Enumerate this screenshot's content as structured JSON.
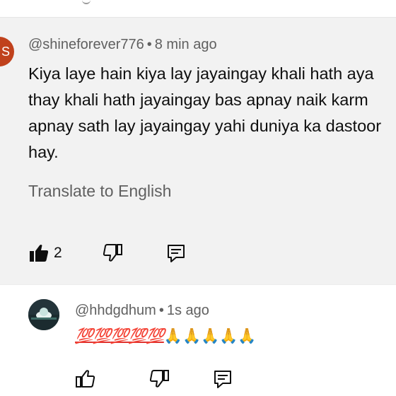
{
  "main_comment": {
    "avatar_letter": "S",
    "avatar_color": "#c0411c",
    "handle": "@shineforever776",
    "separator": "•",
    "time": "8 min ago",
    "body": "Kiya laye hain kiya lay jayaingay khali hath aya thay khali hath jayaingay bas apnay naik karm apnay sath lay jayaingay yahi duniya ka dastoor hay.",
    "translate_label": "Translate to English",
    "like_count": "2",
    "icons": {
      "like": "thumbs-up-filled-icon",
      "dislike": "thumbs-down-icon",
      "reply": "reply-comment-icon"
    }
  },
  "reply_comment": {
    "handle": "@hhdgdhum",
    "separator": "•",
    "time": "1s ago",
    "emoji_hundred": [
      "💯",
      "💯",
      "💯",
      "💯",
      "💯"
    ],
    "emoji_pray": [
      "🙏",
      "🙏",
      "🙏",
      "🙏",
      "🙏"
    ],
    "icons": {
      "like": "thumbs-up-icon",
      "dislike": "thumbs-down-icon",
      "reply": "reply-comment-icon"
    }
  }
}
